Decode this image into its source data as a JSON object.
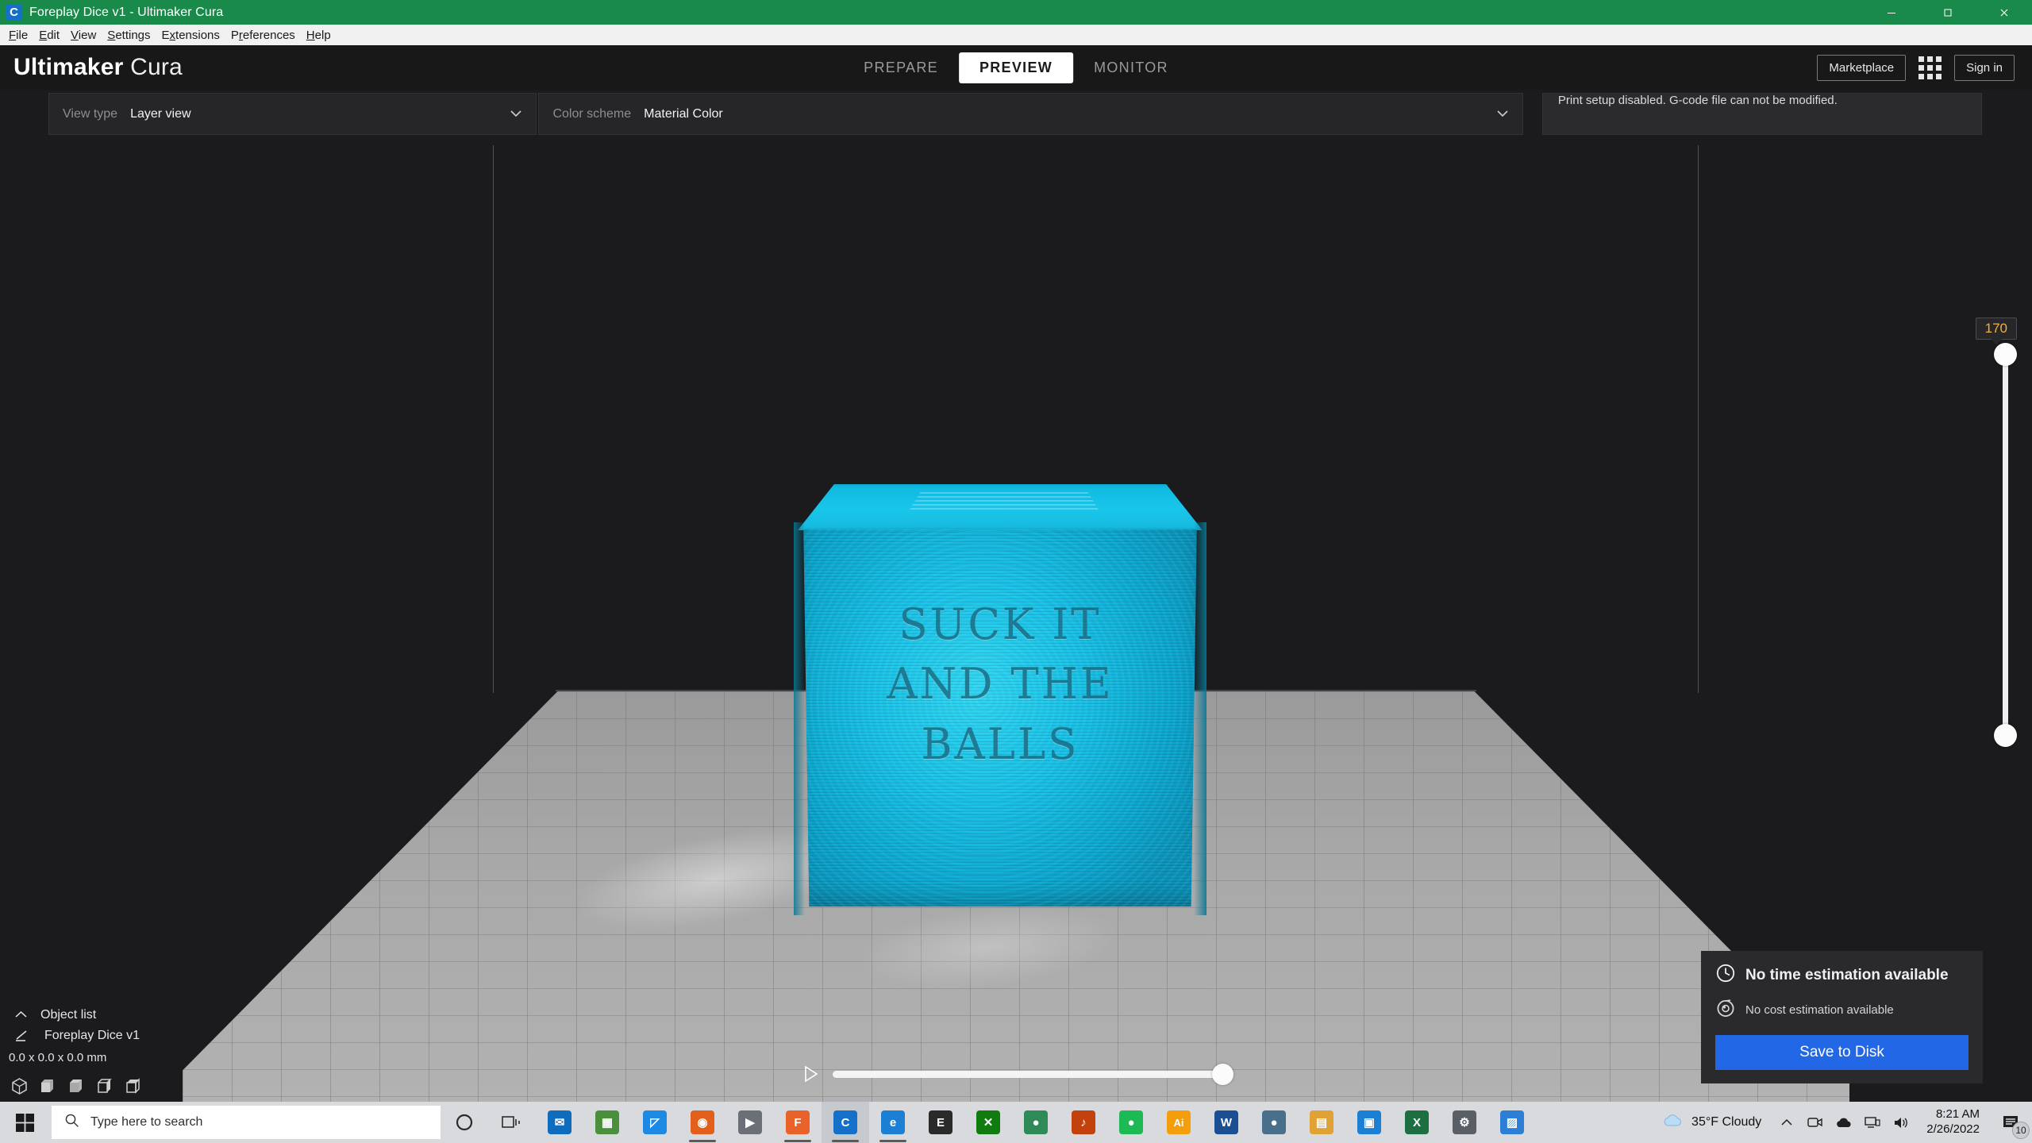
{
  "window": {
    "title": "Foreplay Dice v1 - Ultimaker Cura",
    "app_icon": "cura-logo-icon",
    "minimize": "minimize-icon",
    "maximize": "maximize-icon",
    "close": "close-icon",
    "titlebar_color": "#1a8a4a"
  },
  "menubar": {
    "items": [
      {
        "label": "File",
        "accel": "F"
      },
      {
        "label": "Edit",
        "accel": "E"
      },
      {
        "label": "View",
        "accel": "V"
      },
      {
        "label": "Settings",
        "accel": "S"
      },
      {
        "label": "Extensions",
        "accel": "E"
      },
      {
        "label": "Preferences",
        "accel": "P"
      },
      {
        "label": "Help",
        "accel": "H"
      }
    ]
  },
  "header": {
    "brand_bold": "Ultimaker",
    "brand_light": "Cura",
    "tabs": [
      {
        "label": "PREPARE",
        "active": false
      },
      {
        "label": "PREVIEW",
        "active": true
      },
      {
        "label": "MONITOR",
        "active": false
      }
    ],
    "marketplace_label": "Marketplace",
    "apps_icon": "apps-grid-icon",
    "signin_label": "Sign in"
  },
  "toolbar": {
    "view_type_label": "View type",
    "view_type_value": "Layer view",
    "color_scheme_label": "Color scheme",
    "color_scheme_value": "Material Color",
    "warning_text": "Print setup disabled. G-code file can not be modified.",
    "chevron": "⌄"
  },
  "model": {
    "text_lines": [
      "SUCK IT",
      "AND THE",
      "BALLS"
    ],
    "filament_color": "#17c0e6"
  },
  "layer_slider": {
    "value": "170",
    "value_color": "#f0b045"
  },
  "object_list": {
    "header_label": "Object list",
    "collapse_icon": "chevron-up-icon",
    "item_name": "Foreplay Dice v1",
    "item_icon": "mesh-type-icon",
    "dimensions": "0.0 x 0.0 x 0.0 mm",
    "view_buttons": [
      "view-3d-icon",
      "view-front-icon",
      "view-top-icon",
      "view-left-icon",
      "view-right-icon"
    ]
  },
  "scrubber": {
    "play_icon": "play-icon",
    "position_percent": 100
  },
  "notification": {
    "time_icon": "clock-icon",
    "time_text": "No time estimation available",
    "cost_icon": "filament-spool-icon",
    "cost_text": "No cost estimation available",
    "save_label": "Save to Disk",
    "save_color": "#2267e6"
  },
  "taskbar": {
    "start_icon": "windows-start-icon",
    "search_placeholder": "Type here to search",
    "search_icon": "search-icon",
    "cortana_icon": "cortana-icon",
    "taskview_icon": "task-view-icon",
    "apps": [
      {
        "name": "mail-icon",
        "letter": "✉",
        "color": "#0f6cbd"
      },
      {
        "name": "calculator-icon",
        "letter": "▦",
        "color": "#4a8f3c"
      },
      {
        "name": "photos-icon",
        "letter": "◰",
        "color": "#1e88e5"
      },
      {
        "name": "firefox-icon",
        "letter": "◉",
        "color": "#e35f1c"
      },
      {
        "name": "video-editor-icon",
        "letter": "▶",
        "color": "#6b6f76"
      },
      {
        "name": "flipgrid-icon",
        "letter": "F",
        "color": "#e8622a"
      },
      {
        "name": "cura-icon",
        "letter": "C",
        "color": "#1470c8"
      },
      {
        "name": "edge-icon",
        "letter": "e",
        "color": "#1b7fd4"
      },
      {
        "name": "epic-games-icon",
        "letter": "E",
        "color": "#2a2a2a"
      },
      {
        "name": "xbox-icon",
        "letter": "✕",
        "color": "#107c10"
      },
      {
        "name": "chrome-icon",
        "letter": "●",
        "color": "#2e8b57"
      },
      {
        "name": "music-icon",
        "letter": "♪",
        "color": "#c2410c"
      },
      {
        "name": "spotify-icon",
        "letter": "●",
        "color": "#1db954"
      },
      {
        "name": "illustrator-icon",
        "letter": "Ai",
        "color": "#f59e0b"
      },
      {
        "name": "word-icon",
        "letter": "W",
        "color": "#1a4f91"
      },
      {
        "name": "steam-icon",
        "letter": "●",
        "color": "#4a6f8a"
      },
      {
        "name": "file-explorer-icon",
        "letter": "▤",
        "color": "#e0a135"
      },
      {
        "name": "store-icon",
        "letter": "▣",
        "color": "#1b7fd4"
      },
      {
        "name": "excel-icon",
        "letter": "X",
        "color": "#1d6f42"
      },
      {
        "name": "settings-icon",
        "letter": "⚙",
        "color": "#5a5f66"
      },
      {
        "name": "paint-icon",
        "letter": "▨",
        "color": "#2c7fd4"
      }
    ],
    "weather_icon": "cloud-icon",
    "weather_text": "35°F  Cloudy",
    "chevron_icon": "chevron-up-icon",
    "tray_icons": [
      "camera-icon",
      "onedrive-icon",
      "network-icon",
      "volume-icon"
    ],
    "time": "8:21 AM",
    "date": "2/26/2022",
    "notification_icon": "action-center-icon",
    "notification_count": "10"
  }
}
